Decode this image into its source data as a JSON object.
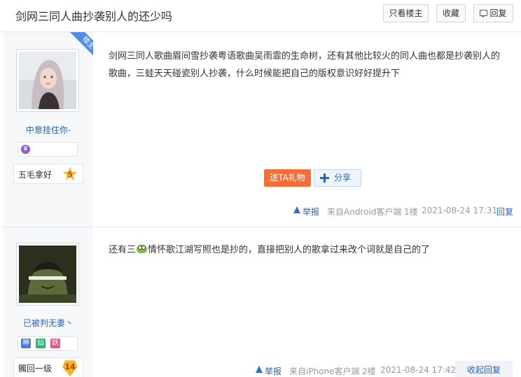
{
  "thread": {
    "title": "剑网三同人曲抄袭别人的还少吗",
    "only_op_label": "只看楼主",
    "favorite_label": "收藏",
    "reply_label": "回复"
  },
  "posts": [
    {
      "username": "中意挂住你-",
      "corner_badge": "楼主",
      "level_name": "五毛拿好",
      "level_num": "5",
      "content": "剑网三同人歌曲眉间雪抄袭粤语歌曲吴雨霏的生命树，还有其他比较火的同人曲也都是抄袭别人的歌曲，三蛙天天碰瓷别人抄袭，什么时候能把自己的版权意识好好提升下",
      "gift_label": "送TA礼物",
      "share_label": "分享",
      "report_label": "举报",
      "source": "来自Android客户端",
      "floor": "1楼",
      "time": "2021-08-24 17:31",
      "reply_label": "回复"
    },
    {
      "username": "已被判无妻丶",
      "tags": [
        "神",
        "仙",
        "妖"
      ],
      "tag_colors": [
        "#4b7bd9",
        "#33b27a",
        "#e0598b"
      ],
      "level_name": "髑回一级",
      "level_num": "14",
      "content_before": "还有三",
      "content_icon": "frog-icon",
      "content_after": "情怀歌江湖写照也是抄的，直接把别人的歌拿过来改个词就是自己的了",
      "report_label": "举报",
      "source": "来自iPhone客户端",
      "floor": "2楼",
      "time": "2021-08-24 17:42",
      "collapse_label": "收起回复"
    }
  ]
}
